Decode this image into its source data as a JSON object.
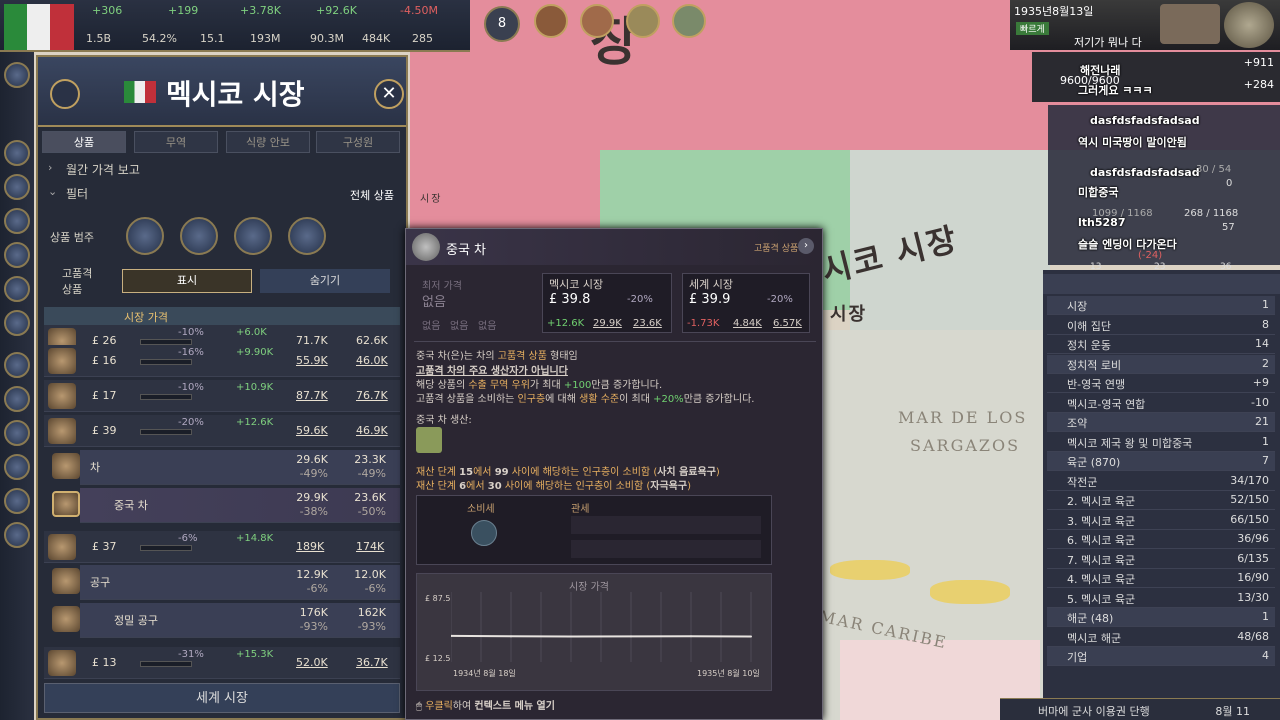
{
  "topbar": {
    "row1": [
      "+306",
      "+199",
      "+3.78K",
      "+92.6K",
      "-4.50M"
    ],
    "row2": [
      "1.5B",
      "54.2%",
      "15.1",
      "193M",
      "90.3M",
      "484K",
      "285"
    ],
    "notifications": "8"
  },
  "date": {
    "text": "1935년8월13일",
    "speed_label": "빠르게",
    "sub": "저기가 뭐나 다 "
  },
  "right_top": {
    "counter": "9600/9600",
    "plus1": "+911",
    "plus2": "+284"
  },
  "chat": [
    {
      "user": "해전나래",
      "msg": "그러게요 ㅋㅋㅋ"
    },
    {
      "user": "dasfdsfadsfadsad",
      "msg": "역시 미국땅이 말이안됨"
    },
    {
      "user": "dasfdsfadsfadsad",
      "msg": "미합중국"
    },
    {
      "user": "lth5287",
      "msg": "슬슬 엔딩이 다가온다"
    }
  ],
  "right_mini": {
    "a": "30 / 54",
    "b": "0",
    "c": "1099 / 1168",
    "d": "268 / 1168",
    "e": "57",
    "f": "(-24)",
    "g": "13",
    "h": "23",
    "i": "36"
  },
  "panel": {
    "title": "멕시코 시장",
    "tabs": [
      "상품",
      "무역",
      "식량 안보",
      "구성원"
    ],
    "monthly_report": "월간 가격 보고",
    "filter": "필터",
    "all_goods": "전체 상품",
    "category_label": "상품 범주",
    "luxury_label": "고품격 상품",
    "show": "표시",
    "hide": "숨기기",
    "col_price": "시장 가격",
    "world_market": "세계 시장",
    "rows": [
      {
        "price": "£ 26",
        "pct": "-10%",
        "delta": "+6.0K",
        "c1": "71.7K",
        "c2": "62.6K"
      },
      {
        "price": "£ 16",
        "pct": "-16%",
        "delta": "+9.90K",
        "c1": "55.9K",
        "c2": "46.0K"
      },
      {
        "price": "£ 17",
        "pct": "-10%",
        "delta": "+10.9K",
        "c1": "87.7K",
        "c2": "76.7K"
      },
      {
        "price": "£ 39",
        "pct": "-20%",
        "delta": "+12.6K",
        "c1": "59.6K",
        "c2": "46.9K"
      }
    ],
    "sub_tea": {
      "name": "차",
      "v1": "29.6K",
      "v1b": "-49%",
      "v2": "23.3K",
      "v2b": "-49%"
    },
    "sub_chtea": {
      "name": "중국 차",
      "v1": "29.9K",
      "v1b": "-38%",
      "v2": "23.6K",
      "v2b": "-50%"
    },
    "row_tools": {
      "price": "£ 37",
      "pct": "-6%",
      "delta": "+14.8K",
      "c1": "189K",
      "c2": "174K"
    },
    "sub_tools": {
      "name": "공구",
      "v1": "12.9K",
      "v1b": "-6%",
      "v2": "12.0K",
      "v2b": "-6%"
    },
    "sub_fine": {
      "name": "정밀 공구",
      "v1": "176K",
      "v1b": "-93%",
      "v2": "162K",
      "v2b": "-93%"
    },
    "row_last": {
      "price": "£ 13",
      "pct": "-31%",
      "delta": "+15.3K",
      "c1": "52.0K",
      "c2": "36.7K"
    }
  },
  "tooltip": {
    "title": "중국 차",
    "tag": "고품격 상품",
    "base_price": "최저 가격",
    "none": "없음",
    "none3": [
      "없음",
      "없음",
      "없음"
    ],
    "mex_market": "멕시코 시장",
    "mex_price": "£ 39.8",
    "mex_pct": "-20%",
    "mex_vals": [
      "+12.6K",
      "29.9K",
      "23.6K"
    ],
    "world_market": "세계 시장",
    "world_price": "£ 39.9",
    "world_pct": "-20%",
    "world_vals": [
      "-1.73K",
      "4.84K",
      "6.57K"
    ],
    "line1a": "중국 차(은)는 ",
    "line1b": "차의 ",
    "line1c": "고품격 상품",
    "line1d": " 형태임",
    "line2": "고품격 차의 주요 생산자가 아닙니다",
    "line3a": "해당 상품의 ",
    "line3b": "수출 무역 우위",
    "line3c": "가 최대 ",
    "line3d": "+100",
    "line3e": "만큼 증가합니다.",
    "line4a": "고품격 상품을 소비하는 ",
    "line4b": "인구층",
    "line4c": "에 대해 ",
    "line4d": "생활 수준",
    "line4e": "이 최대 ",
    "line4f": "+20%",
    "line4g": "만큼 증가합니다.",
    "prod_label": "중국 차 생산:",
    "cons1a": "재산 단계 ",
    "cons1b": "15",
    "cons1c": "에서 ",
    "cons1d": "99",
    "cons1e": " 사이에 해당하는 ",
    "cons1f": "인구층",
    "cons1g": "이 소비함 (",
    "cons1h": "사치 음료욕구",
    "cons1i": ")",
    "cons2a": "재산 단계 ",
    "cons2b": "6",
    "cons2c": "에서 ",
    "cons2d": "30",
    "cons2e": " 사이에 해당하는 ",
    "cons2f": "인구층",
    "cons2g": "이 소비함 (",
    "cons2h": "자극욕구",
    "cons2i": ")",
    "consumption": "소비세",
    "tariff": "관세",
    "chart_title": "시장 가격",
    "y_top": "£ 87.5",
    "y_bot": "£ 12.5",
    "x_left": "1934년 8월 18일",
    "x_right": "1935년 8월 10일",
    "hint_a": "우클릭",
    "hint_b": "하여 ",
    "hint_c": "컨텍스트 메뉴 열기"
  },
  "chart_data": {
    "type": "line",
    "title": "시장 가격",
    "x": [
      "1934년 8월 18일",
      "1935년 8월 10일"
    ],
    "series": [
      {
        "values": [
          40.5,
          40.0,
          39.8,
          39.9,
          40.1,
          39.8
        ]
      }
    ],
    "ylim": [
      12.5,
      87.5
    ]
  },
  "map": {
    "label1": "시코 시장",
    "label2": "시장",
    "label3": "장",
    "sea1": "MAR DE LOS",
    "sea2": "SARGAZOS",
    "sea3": "MAR CARIBE",
    "small": "시장"
  },
  "right_list": {
    "items": [
      {
        "label": "시장",
        "val": "1"
      },
      {
        "label": "이해 집단",
        "val": "8"
      },
      {
        "label": "정치 운동",
        "val": "14"
      },
      {
        "label": "정치적 로비",
        "val": "2"
      },
      {
        "label": "반-영국 연맹",
        "val": "+9"
      },
      {
        "label": "멕시코-영국 연합",
        "val": "-10"
      },
      {
        "label": "조약",
        "val": "21"
      },
      {
        "label": "멕시코 제국 왕 및 미합중국",
        "val": "1"
      },
      {
        "label": "육군 (870)",
        "val": "7"
      },
      {
        "label": "작전군",
        "val": "34/170"
      },
      {
        "label": "2. 멕시코 육군",
        "val": "52/150"
      },
      {
        "label": "3. 멕시코 육군",
        "val": "66/150"
      },
      {
        "label": "6. 멕시코 육군",
        "val": "36/96"
      },
      {
        "label": "7. 멕시코 육군",
        "val": "6/135"
      },
      {
        "label": "4. 멕시코 육군",
        "val": "16/90"
      },
      {
        "label": "5. 멕시코 육군",
        "val": "13/30"
      },
      {
        "label": "해군 (48)",
        "val": "1"
      },
      {
        "label": "멕시코 해군",
        "val": "48/68"
      },
      {
        "label": "기업",
        "val": "4"
      }
    ]
  },
  "bottom_right": {
    "text": "버마에 군사 이용권 단행",
    "date": "8월 11"
  }
}
